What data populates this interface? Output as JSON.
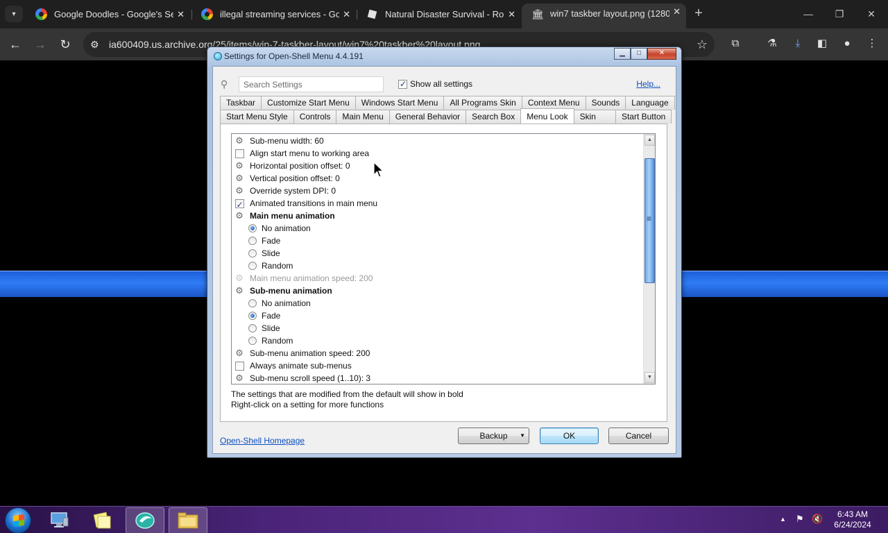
{
  "browser": {
    "tabs": [
      {
        "title": "Google Doodles - Google's Se",
        "favicon": "google-icon",
        "active": false
      },
      {
        "title": "illegal streaming services - Go",
        "favicon": "google-icon",
        "active": false
      },
      {
        "title": "Natural Disaster Survival - Rob",
        "favicon": "roblox-icon",
        "active": false
      },
      {
        "title": "win7 taskber layout.png (1280",
        "favicon": "archive-icon",
        "active": true
      }
    ],
    "url": "ia600409.us.archive.org/25/items/win-7-taskber-layout/win7%20taskber%20layout.png"
  },
  "dialog": {
    "title": "Settings for Open-Shell Menu 4.4.191",
    "search_placeholder": "Search Settings",
    "show_all_label": "Show all settings",
    "show_all_checked": true,
    "help_label": "Help...",
    "tabs_row1": [
      "Taskbar",
      "Customize Start Menu",
      "Windows Start Menu",
      "All Programs Skin",
      "Context Menu",
      "Sounds",
      "Language"
    ],
    "tabs_row2": [
      "Start Menu Style",
      "Controls",
      "Main Menu",
      "General Behavior",
      "Search Box",
      "Menu Look",
      "Skin",
      "Start Button"
    ],
    "active_tab": "Menu Look",
    "settings": [
      {
        "label": "Sub-menu width: 60",
        "kind": "value",
        "state": ""
      },
      {
        "label": "Align start menu to working area",
        "kind": "checkbox",
        "state": "off"
      },
      {
        "label": "Horizontal position offset: 0",
        "kind": "value",
        "state": ""
      },
      {
        "label": "Vertical position offset: 0",
        "kind": "value",
        "state": ""
      },
      {
        "label": "Override system DPI: 0",
        "kind": "value",
        "state": ""
      },
      {
        "label": "Animated transitions in main menu",
        "kind": "checkbox",
        "state": "on"
      },
      {
        "label": "Main menu animation",
        "kind": "group",
        "state": "bold"
      },
      {
        "label": "No animation",
        "kind": "radio",
        "state": "on"
      },
      {
        "label": "Fade",
        "kind": "radio",
        "state": "off"
      },
      {
        "label": "Slide",
        "kind": "radio",
        "state": "off"
      },
      {
        "label": "Random",
        "kind": "radio",
        "state": "off"
      },
      {
        "label": "Main menu animation speed: 200",
        "kind": "value",
        "state": "disabled"
      },
      {
        "label": "Sub-menu animation",
        "kind": "group",
        "state": "bold"
      },
      {
        "label": "No animation",
        "kind": "radio",
        "state": "off"
      },
      {
        "label": "Fade",
        "kind": "radio",
        "state": "on"
      },
      {
        "label": "Slide",
        "kind": "radio",
        "state": "off"
      },
      {
        "label": "Random",
        "kind": "radio",
        "state": "off"
      },
      {
        "label": "Sub-menu animation speed: 200",
        "kind": "value",
        "state": ""
      },
      {
        "label": "Always animate sub-menus",
        "kind": "checkbox",
        "state": "off"
      },
      {
        "label": "Sub-menu scroll speed (1..10): 3",
        "kind": "value",
        "state": ""
      }
    ],
    "info_line1": "The settings that are modified from the default will show in bold",
    "info_line2": "Right-click on a setting for more functions",
    "homepage_label": "Open-Shell Homepage",
    "backup_label": "Backup",
    "ok_label": "OK",
    "cancel_label": "Cancel"
  },
  "taskbar": {
    "time": "6:43 AM",
    "date": "6/24/2024"
  },
  "colors": {
    "accent_blue": "#2f7cf5",
    "taskbar_purple": "#4a2478",
    "link_blue": "#0b4ec0"
  }
}
